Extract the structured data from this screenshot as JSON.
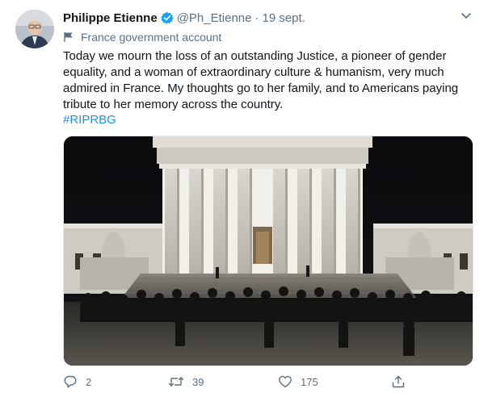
{
  "tweet": {
    "author_name": "Philippe Etienne",
    "handle": "@Ph_Etienne",
    "separator": "·",
    "date": "19 sept.",
    "account_label": "France government account",
    "text": "Today we mourn the loss of an outstanding Justice, a pioneer of gender equality, and a woman of extraordinary culture & humanism, very much admired in France. My thoughts go to her family, and to Americans paying tribute to her memory across the country.",
    "hashtag": "#RIPRBG",
    "replies": "2",
    "retweets": "39",
    "likes": "175"
  },
  "icons": {
    "verified": "verified-badge-icon",
    "caret": "chevron-down-icon",
    "flag": "flag-icon",
    "reply": "reply-icon",
    "retweet": "retweet-icon",
    "like": "heart-icon",
    "share": "share-icon"
  },
  "colors": {
    "link": "#1b95e0",
    "muted": "#5b7083",
    "verified": "#1da1f2"
  }
}
